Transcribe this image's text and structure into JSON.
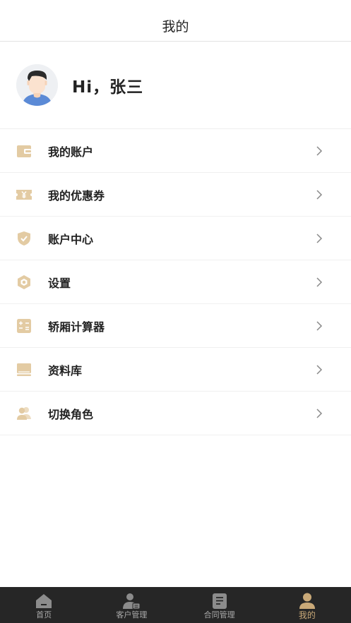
{
  "header": {
    "title": "我的"
  },
  "profile": {
    "greeting": "Hi，张三"
  },
  "menu": [
    {
      "label": "我的账户",
      "icon": "wallet-icon"
    },
    {
      "label": "我的优惠券",
      "icon": "coupon-icon"
    },
    {
      "label": "账户中心",
      "icon": "shield-icon"
    },
    {
      "label": "设置",
      "icon": "hexagon-settings-icon"
    },
    {
      "label": "轿厢计算器",
      "icon": "calculator-icon"
    },
    {
      "label": "资料库",
      "icon": "library-icon"
    },
    {
      "label": "切换角色",
      "icon": "switch-role-icon"
    }
  ],
  "tabs": [
    {
      "label": "首页",
      "icon": "home-icon",
      "active": false
    },
    {
      "label": "客户管理",
      "icon": "customer-icon",
      "active": false
    },
    {
      "label": "合同管理",
      "icon": "contract-icon",
      "active": false
    },
    {
      "label": "我的",
      "icon": "profile-icon",
      "active": true
    }
  ],
  "colors": {
    "accent": "#c9a978",
    "icon_tint": "#e3cba3",
    "tabbar_bg": "#262626",
    "tab_inactive": "#a9a9a9"
  }
}
